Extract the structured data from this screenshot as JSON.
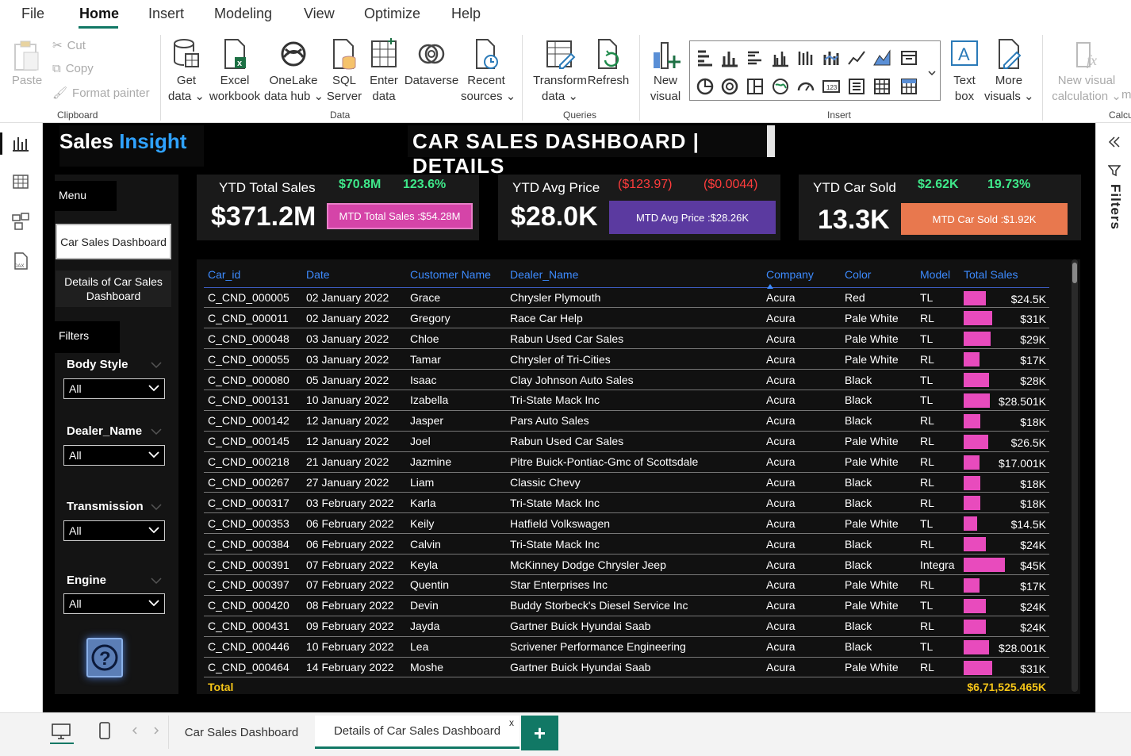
{
  "menu": [
    "File",
    "Home",
    "Insert",
    "Modeling",
    "View",
    "Optimize",
    "Help"
  ],
  "ribbon": {
    "clipboard": {
      "paste": "Paste",
      "cut": "Cut",
      "copy": "Copy",
      "format_painter": "Format painter",
      "group": "Clipboard"
    },
    "data": {
      "get_data": "Get\ndata ⌄",
      "excel": "Excel\nworkbook",
      "onelake": "OneLake\ndata hub ⌄",
      "sql": "SQL\nServer",
      "enter": "Enter\ndata",
      "dataverse": "Dataverse",
      "recent": "Recent\nsources ⌄",
      "group": "Data"
    },
    "queries": {
      "transform": "Transform\ndata ⌄",
      "refresh": "Refresh",
      "group": "Queries"
    },
    "insert": {
      "new_visual": "New\nvisual",
      "text_box": "Text\nbox",
      "more_visuals": "More\nvisuals ⌄",
      "group": "Insert"
    },
    "calc": {
      "new_visual_calc": "New visual\ncalculation ⌄",
      "more": "m",
      "group": "Calcu"
    }
  },
  "header": {
    "brand_sales": "Sales",
    "brand_insight": "Insight",
    "title": "CAR  SALES  DASHBOARD | DETAILS"
  },
  "sidebar": {
    "menu_label": "Menu",
    "nav_main": "Car Sales Dashboard",
    "nav_details": "Details of Car Sales Dashboard",
    "filters_label": "Filters",
    "filters": [
      {
        "title": "Body Style",
        "value": "All"
      },
      {
        "title": "Dealer_Name",
        "value": "All"
      },
      {
        "title": "Transmission",
        "value": "All"
      },
      {
        "title": "Engine",
        "value": "All"
      }
    ]
  },
  "kpis": [
    {
      "name": "YTD Total Sales",
      "value": "$371.2M",
      "v1": "$70.8M",
      "v2": "123.6%",
      "mtd": "MTD Total Sales :$54.28M",
      "mtd_color": "#d544a8",
      "v1_state": "pos",
      "v2_state": "pos"
    },
    {
      "name": "YTD Avg Price",
      "value": "$28.0K",
      "v1": "($123.97)",
      "v2": "($0.0044)",
      "mtd": "MTD Avg Price :$28.26K",
      "mtd_color": "#5b3aa0",
      "v1_state": "neg",
      "v2_state": "neg"
    },
    {
      "name": "YTD Car Sold",
      "value": "13.3K",
      "v1": "$2.62K",
      "v2": "19.73%",
      "mtd": "MTD Car Sold :$1.92K",
      "mtd_color": "#e8784e",
      "v1_state": "pos",
      "v2_state": "pos"
    }
  ],
  "table": {
    "columns": [
      "Car_id",
      "Date",
      "Customer Name",
      "Dealer_Name",
      "Company",
      "Color",
      "Model",
      "Total Sales"
    ],
    "rows": [
      [
        "C_CND_000005",
        "02 January 2022",
        "Grace",
        "Chrysler Plymouth",
        "Acura",
        "Red",
        "TL",
        "$24.5K",
        24.5
      ],
      [
        "C_CND_000011",
        "02 January 2022",
        "Gregory",
        "Race Car Help",
        "Acura",
        "Pale White",
        "RL",
        "$31K",
        31
      ],
      [
        "C_CND_000048",
        "03 January 2022",
        "Chloe",
        "Rabun Used Car Sales",
        "Acura",
        "Pale White",
        "TL",
        "$29K",
        29
      ],
      [
        "C_CND_000055",
        "03 January 2022",
        "Tamar",
        "Chrysler of Tri-Cities",
        "Acura",
        "Pale White",
        "RL",
        "$17K",
        17
      ],
      [
        "C_CND_000080",
        "05 January 2022",
        "Isaac",
        "Clay Johnson Auto Sales",
        "Acura",
        "Black",
        "TL",
        "$28K",
        28
      ],
      [
        "C_CND_000131",
        "10 January 2022",
        "Izabella",
        "Tri-State Mack Inc",
        "Acura",
        "Black",
        "TL",
        "$28.501K",
        28.501
      ],
      [
        "C_CND_000142",
        "12 January 2022",
        "Jasper",
        "Pars Auto Sales",
        "Acura",
        "Black",
        "RL",
        "$18K",
        18
      ],
      [
        "C_CND_000145",
        "12 January 2022",
        "Joel",
        "Rabun Used Car Sales",
        "Acura",
        "Pale White",
        "RL",
        "$26.5K",
        26.5
      ],
      [
        "C_CND_000218",
        "21 January 2022",
        "Jazmine",
        "Pitre Buick-Pontiac-Gmc of Scottsdale",
        "Acura",
        "Pale White",
        "RL",
        "$17.001K",
        17.001
      ],
      [
        "C_CND_000267",
        "27 January 2022",
        "Liam",
        "Classic Chevy",
        "Acura",
        "Black",
        "RL",
        "$18K",
        18
      ],
      [
        "C_CND_000317",
        "03 February 2022",
        "Karla",
        "Tri-State Mack Inc",
        "Acura",
        "Black",
        "RL",
        "$18K",
        18
      ],
      [
        "C_CND_000353",
        "06 February 2022",
        "Keily",
        "Hatfield Volkswagen",
        "Acura",
        "Pale White",
        "TL",
        "$14.5K",
        14.5
      ],
      [
        "C_CND_000384",
        "06 February 2022",
        "Calvin",
        "Tri-State Mack Inc",
        "Acura",
        "Black",
        "RL",
        "$24K",
        24
      ],
      [
        "C_CND_000391",
        "07 February 2022",
        "Keyla",
        "McKinney Dodge Chrysler Jeep",
        "Acura",
        "Black",
        "Integra",
        "$45K",
        45
      ],
      [
        "C_CND_000397",
        "07 February 2022",
        "Quentin",
        "Star Enterprises Inc",
        "Acura",
        "Pale White",
        "RL",
        "$17K",
        17
      ],
      [
        "C_CND_000420",
        "08 February 2022",
        "Devin",
        "Buddy Storbeck's Diesel Service Inc",
        "Acura",
        "Pale White",
        "TL",
        "$24K",
        24
      ],
      [
        "C_CND_000431",
        "09 February 2022",
        "Jayda",
        "Gartner Buick Hyundai Saab",
        "Acura",
        "Black",
        "RL",
        "$24K",
        24
      ],
      [
        "C_CND_000446",
        "10 February 2022",
        "Lea",
        "Scrivener Performance Engineering",
        "Acura",
        "Black",
        "TL",
        "$28.001K",
        28.001
      ],
      [
        "C_CND_000464",
        "14 February 2022",
        "Moshe",
        "Gartner Buick Hyundai Saab",
        "Acura",
        "Pale White",
        "RL",
        "$31K",
        31
      ]
    ],
    "total_label": "Total",
    "total_value": "$6,71,525.465K"
  },
  "right_pane": {
    "filters": "Filters"
  },
  "pages": {
    "tab1": "Car Sales Dashboard",
    "tab2": "Details of Car Sales Dashboard",
    "close": "x",
    "add": "+"
  }
}
